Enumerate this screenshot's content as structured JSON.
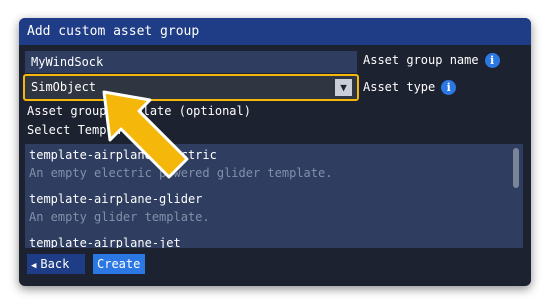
{
  "dialog": {
    "title": "Add custom asset group",
    "name_value": "MyWindSock",
    "name_label": "Asset group name",
    "type_value": "SimObject",
    "type_label": "Asset type",
    "template_label": "Asset group template (optional)",
    "select_template_label": "Select Template",
    "templates": [
      {
        "title": "template-airplane-electric",
        "desc": "An empty electric powered glider template."
      },
      {
        "title": "template-airplane-glider",
        "desc": "An empty glider template."
      },
      {
        "title": "template-airplane-jet",
        "desc": ""
      }
    ],
    "back_label": "Back",
    "create_label": "Create",
    "info_glyph": "i",
    "dropdown_glyph": "▼",
    "back_glyph": "◀"
  },
  "colors": {
    "title_bar": "#1f3c87",
    "dialog_bg": "#1d2230",
    "field_bg": "#2e3d60",
    "highlight": "#f4b70a",
    "info_icon": "#2b78e4"
  },
  "icons": [
    "info-icon",
    "dropdown-arrow-icon",
    "back-arrow-icon",
    "pointer-arrow-icon"
  ]
}
